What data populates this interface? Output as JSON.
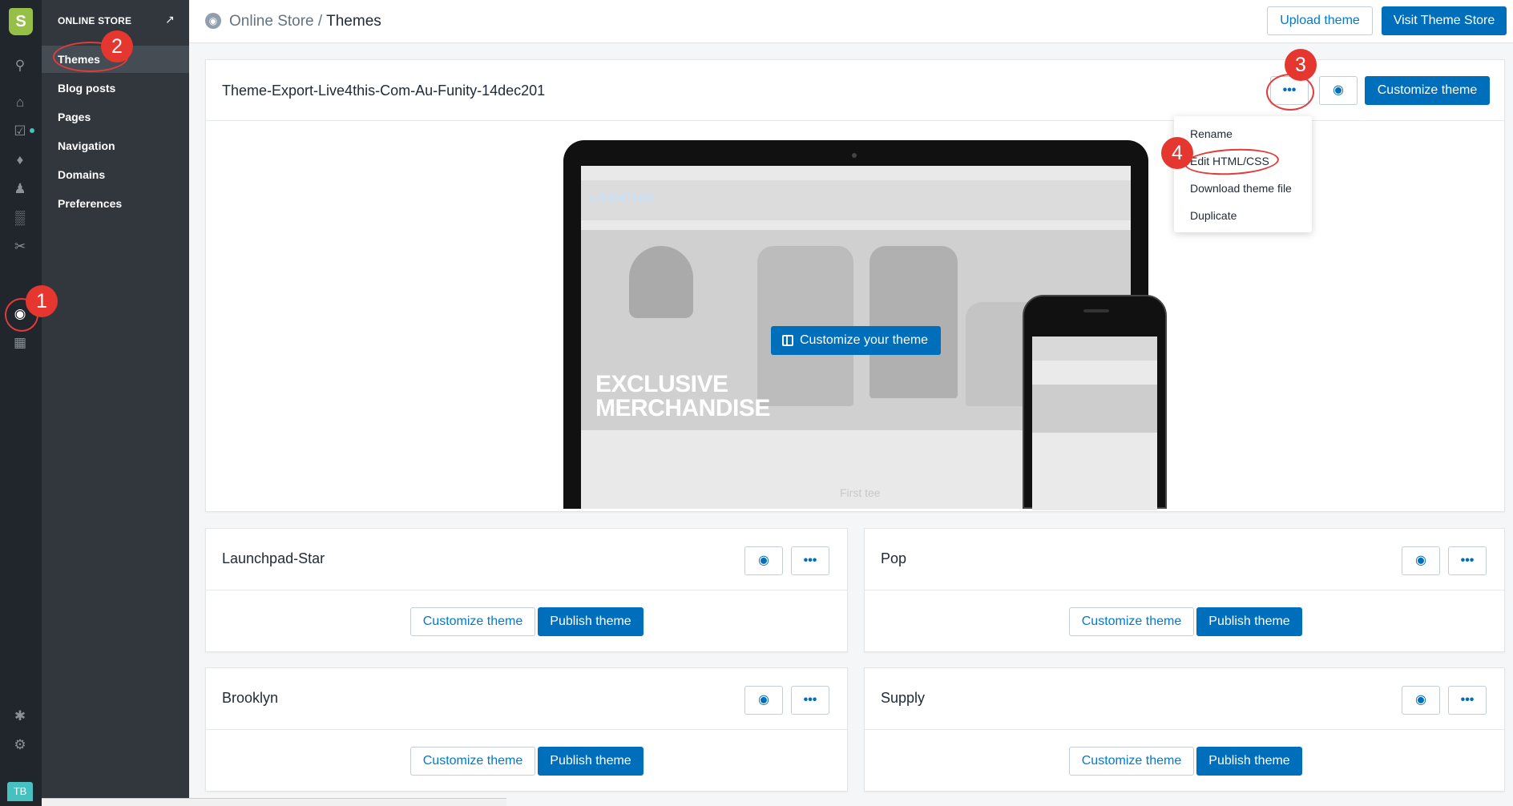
{
  "rail": {
    "logo": "S",
    "avatar": "TB",
    "icons": [
      "search-icon",
      "home-icon",
      "orders-icon",
      "products-icon",
      "customers-icon",
      "analytics-icon",
      "discounts-icon",
      "online-store-icon",
      "sales-channel-icon",
      "apps-icon",
      "settings-icon"
    ]
  },
  "subnav": {
    "header": "ONLINE STORE",
    "items": [
      "Themes",
      "Blog posts",
      "Pages",
      "Navigation",
      "Domains",
      "Preferences"
    ]
  },
  "header": {
    "breadcrumb_parent": "Online Store",
    "separator": "/",
    "breadcrumb_current": "Themes",
    "upload_label": "Upload theme",
    "visit_label": "Visit Theme Store"
  },
  "current_theme": {
    "name": "Theme-Export-Live4this-Com-Au-Funity-14dec201",
    "more_label": "•••",
    "customize_label": "Customize theme",
    "preview_cta": "Customize your theme",
    "preview_logo": "LIVE4THIS",
    "preview_hero_line1": "EXCLUSIVE",
    "preview_hero_line2": "MERCHANDISE",
    "preview_footer": "First tee"
  },
  "actions_menu": {
    "items": [
      "Rename",
      "Edit HTML/CSS",
      "Download theme file",
      "Duplicate"
    ]
  },
  "library": [
    {
      "name": "Launchpad-Star",
      "more_label": "•••",
      "customize_label": "Customize theme",
      "publish_label": "Publish theme"
    },
    {
      "name": "Pop",
      "more_label": "•••",
      "customize_label": "Customize theme",
      "publish_label": "Publish theme"
    },
    {
      "name": "Brooklyn",
      "more_label": "•••",
      "customize_label": "Customize theme",
      "publish_label": "Publish theme"
    },
    {
      "name": "Supply",
      "more_label": "•••",
      "customize_label": "Customize theme",
      "publish_label": "Publish theme"
    }
  ],
  "annotations": [
    "1",
    "2",
    "3",
    "4"
  ],
  "colors": {
    "primary": "#006fbb",
    "sidebar": "#31373d",
    "rail": "#20262b",
    "annotation": "#e5362f"
  }
}
